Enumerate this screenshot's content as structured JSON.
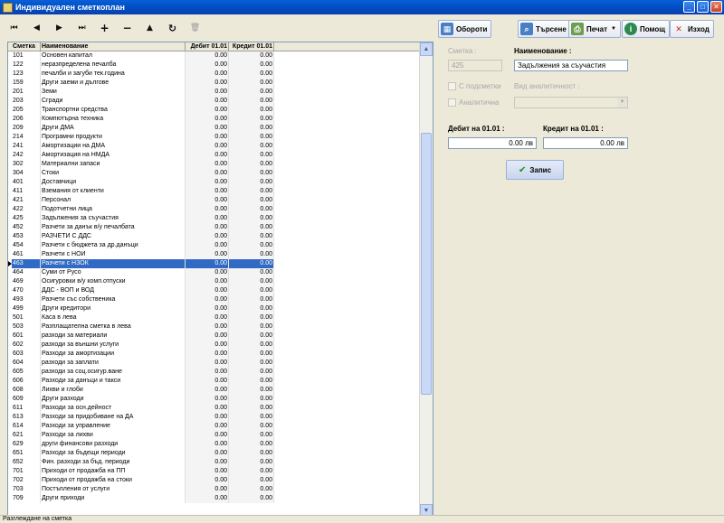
{
  "window": {
    "title": "Индивидуален сметкоплан"
  },
  "nav_toolbar": {
    "first": "⏮",
    "prev": "◀",
    "next": "▶",
    "last": "⏭",
    "add": "+",
    "remove": "−",
    "up": "▲",
    "refresh": "↻",
    "delete": "🗑"
  },
  "grid": {
    "headers": {
      "account": "Сметка",
      "name": "Наименование",
      "debit": "Дебит 01.01",
      "credit": "Кредит 01.01"
    },
    "selected_index": 23,
    "rows": [
      [
        "101",
        "Основен капитал",
        "0.00",
        "0.00"
      ],
      [
        "122",
        "неразпределена печалба",
        "0.00",
        "0.00"
      ],
      [
        "123",
        "печалби и загуби тек.година",
        "0.00",
        "0.00"
      ],
      [
        "159",
        "Други заеми и дългове",
        "0.00",
        "0.00"
      ],
      [
        "201",
        "Земи",
        "0.00",
        "0.00"
      ],
      [
        "203",
        "Сгради",
        "0.00",
        "0.00"
      ],
      [
        "205",
        "Транспортни средства",
        "0.00",
        "0.00"
      ],
      [
        "206",
        "Компютърна техника",
        "0.00",
        "0.00"
      ],
      [
        "209",
        "Други ДМА",
        "0.00",
        "0.00"
      ],
      [
        "214",
        "Програмни продукти",
        "0.00",
        "0.00"
      ],
      [
        "241",
        "Амортизации на ДМА",
        "0.00",
        "0.00"
      ],
      [
        "242",
        "Амортизация на НМДА",
        "0.00",
        "0.00"
      ],
      [
        "302",
        "Материални запаси",
        "0.00",
        "0.00"
      ],
      [
        "304",
        "Стоки",
        "0.00",
        "0.00"
      ],
      [
        "401",
        "Доставчици",
        "0.00",
        "0.00"
      ],
      [
        "411",
        "Вземания от клиенти",
        "0.00",
        "0.00"
      ],
      [
        "421",
        "Персонал",
        "0.00",
        "0.00"
      ],
      [
        "422",
        "Подотчетни лица",
        "0.00",
        "0.00"
      ],
      [
        "425",
        "Задължения за съучастия",
        "0.00",
        "0.00"
      ],
      [
        "452",
        "Разчети за данък в/у печалбата",
        "0.00",
        "0.00"
      ],
      [
        "453",
        "РАЗЧЕТИ С ДДС",
        "0.00",
        "0.00"
      ],
      [
        "454",
        "Разчети с бюджета за др.данъци",
        "0.00",
        "0.00"
      ],
      [
        "461",
        "Разчети с НОИ",
        "0.00",
        "0.00"
      ],
      [
        "463",
        "Разчети с НЗОК",
        "0.00",
        "0.00"
      ],
      [
        "464",
        "Суми от Русо",
        "0.00",
        "0.00"
      ],
      [
        "469",
        "Осигуровки в/у комп.отпуски",
        "0.00",
        "0.00"
      ],
      [
        "470",
        "ДДС - ВОП и ВОД",
        "0.00",
        "0.00"
      ],
      [
        "493",
        "Разчети със собственика",
        "0.00",
        "0.00"
      ],
      [
        "499",
        "Други кредитори",
        "0.00",
        "0.00"
      ],
      [
        "501",
        "Каса в лева",
        "0.00",
        "0.00"
      ],
      [
        "503",
        "Разплащателна сметка в лева",
        "0.00",
        "0.00"
      ],
      [
        "601",
        "разходи за материали",
        "0.00",
        "0.00"
      ],
      [
        "602",
        "разходи за външни услуги",
        "0.00",
        "0.00"
      ],
      [
        "603",
        "Разходи за амортизации",
        "0.00",
        "0.00"
      ],
      [
        "604",
        "разходи за заплати",
        "0.00",
        "0.00"
      ],
      [
        "605",
        "разходи за соц.осигур.ване",
        "0.00",
        "0.00"
      ],
      [
        "606",
        "Разходи за данъци и такси",
        "0.00",
        "0.00"
      ],
      [
        "608",
        "Лихви и глоби",
        "0.00",
        "0.00"
      ],
      [
        "609",
        "Други разходи",
        "0.00",
        "0.00"
      ],
      [
        "611",
        "Разходи за осн.дейност",
        "0.00",
        "0.00"
      ],
      [
        "613",
        "Разходи за придобиване на ДА",
        "0.00",
        "0.00"
      ],
      [
        "614",
        "Разходи за управление",
        "0.00",
        "0.00"
      ],
      [
        "621",
        "Разходи за лихви",
        "0.00",
        "0.00"
      ],
      [
        "629",
        "други финансови разходи",
        "0.00",
        "0.00"
      ],
      [
        "651",
        "Разходи за бъдещи периоди",
        "0.00",
        "0.00"
      ],
      [
        "652",
        "Фин. разходи за бъд. периоди",
        "0.00",
        "0.00"
      ],
      [
        "701",
        "Приходи от продажба на ПП",
        "0.00",
        "0.00"
      ],
      [
        "702",
        "Приходи от продажба на стоки",
        "0.00",
        "0.00"
      ],
      [
        "703",
        "Постъпления от услуги",
        "0.00",
        "0.00"
      ],
      [
        "709",
        "Други приходи",
        "0.00",
        "0.00"
      ]
    ]
  },
  "toolbar": {
    "turnover": "Обороти",
    "search": "Търсене",
    "print": "Печат",
    "help": "Помощ",
    "exit": "Изход"
  },
  "form": {
    "account_label": "Сметка :",
    "account_value": "425",
    "name_label": "Наименование :",
    "name_value": "Задължения за съучастия",
    "subaccounts_label": "С подсметки",
    "analytical_label": "Аналитична",
    "analytic_type_label": "Вид аналитичност :",
    "analytic_type_value": "",
    "debit_label": "Дебит на 01.01 :",
    "debit_value": "0.00 лв",
    "credit_label": "Кредит на 01.01 :",
    "credit_value": "0.00 лв",
    "save": "Запис"
  },
  "statusbar": {
    "text": "Разглеждане на сметка"
  }
}
